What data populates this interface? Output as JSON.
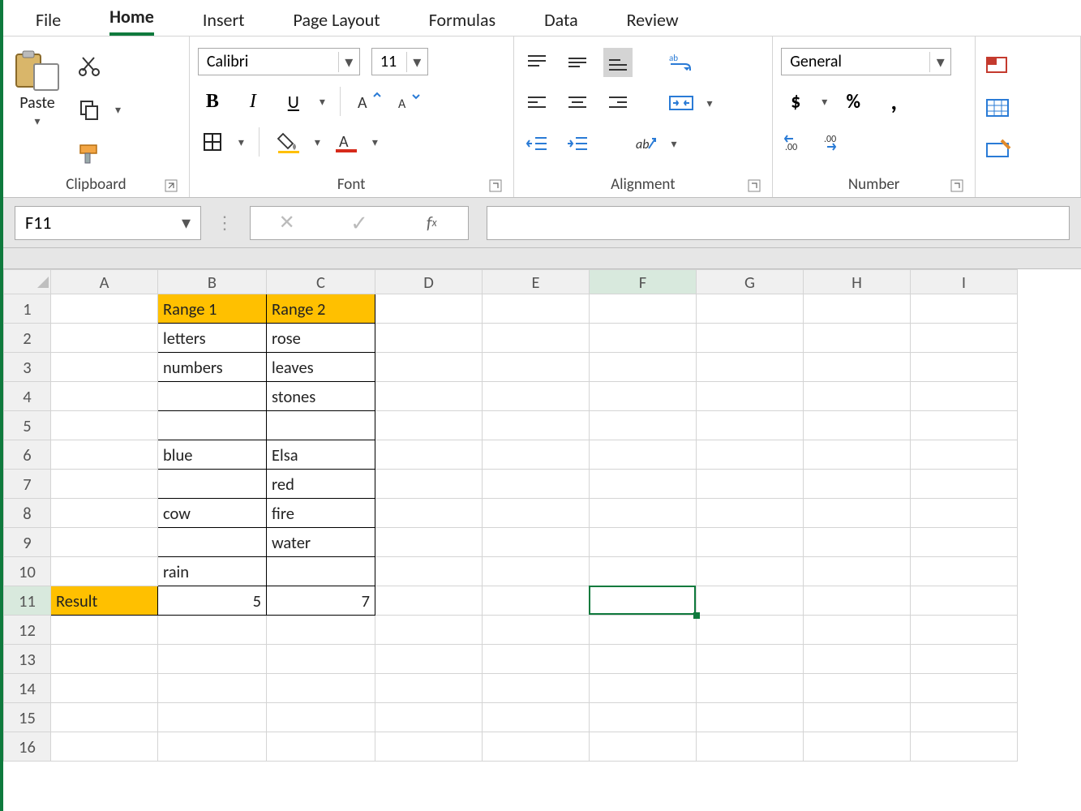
{
  "tabs": [
    "File",
    "Home",
    "Insert",
    "Page Layout",
    "Formulas",
    "Data",
    "Review"
  ],
  "active_tab": "Home",
  "ribbon": {
    "clipboard_label": "Clipboard",
    "paste_label": "Paste",
    "font_label": "Font",
    "font_name": "Calibri",
    "font_size": "11",
    "alignment_label": "Alignment",
    "number_label": "Number",
    "number_format": "General"
  },
  "namebox": "F11",
  "formula": "",
  "columns": [
    "A",
    "B",
    "C",
    "D",
    "E",
    "F",
    "G",
    "H",
    "I"
  ],
  "row_count": 16,
  "selected_cell": {
    "col": "F",
    "row": 11
  },
  "cells": {
    "B1": {
      "v": "Range 1",
      "cls": "hdr-yellow"
    },
    "C1": {
      "v": "Range 2",
      "cls": "hdr-yellow"
    },
    "B2": {
      "v": "letters",
      "cls": "boxed"
    },
    "C2": {
      "v": "rose",
      "cls": "boxed"
    },
    "B3": {
      "v": "numbers",
      "cls": "boxed"
    },
    "C3": {
      "v": "leaves",
      "cls": "boxed"
    },
    "B4": {
      "v": "",
      "cls": "boxed"
    },
    "C4": {
      "v": "stones",
      "cls": "boxed"
    },
    "B5": {
      "v": "",
      "cls": "boxed"
    },
    "C5": {
      "v": "",
      "cls": "boxed"
    },
    "B6": {
      "v": "blue",
      "cls": "boxed"
    },
    "C6": {
      "v": "Elsa",
      "cls": "boxed"
    },
    "B7": {
      "v": "",
      "cls": "boxed"
    },
    "C7": {
      "v": "red",
      "cls": "boxed"
    },
    "B8": {
      "v": "cow",
      "cls": "boxed"
    },
    "C8": {
      "v": "fire",
      "cls": "boxed"
    },
    "B9": {
      "v": "",
      "cls": "boxed"
    },
    "C9": {
      "v": "water",
      "cls": "boxed"
    },
    "B10": {
      "v": "rain",
      "cls": "boxed"
    },
    "C10": {
      "v": "",
      "cls": "boxed"
    },
    "A11": {
      "v": "Result",
      "cls": "res-yellow"
    },
    "B11": {
      "v": "5",
      "cls": "boxed",
      "align": "right"
    },
    "C11": {
      "v": "7",
      "cls": "boxed",
      "align": "right"
    }
  },
  "col_widths": {
    "A": 132,
    "B": 134,
    "C": 134,
    "D": 132,
    "E": 132,
    "F": 132,
    "G": 132,
    "H": 132,
    "I": 132
  }
}
